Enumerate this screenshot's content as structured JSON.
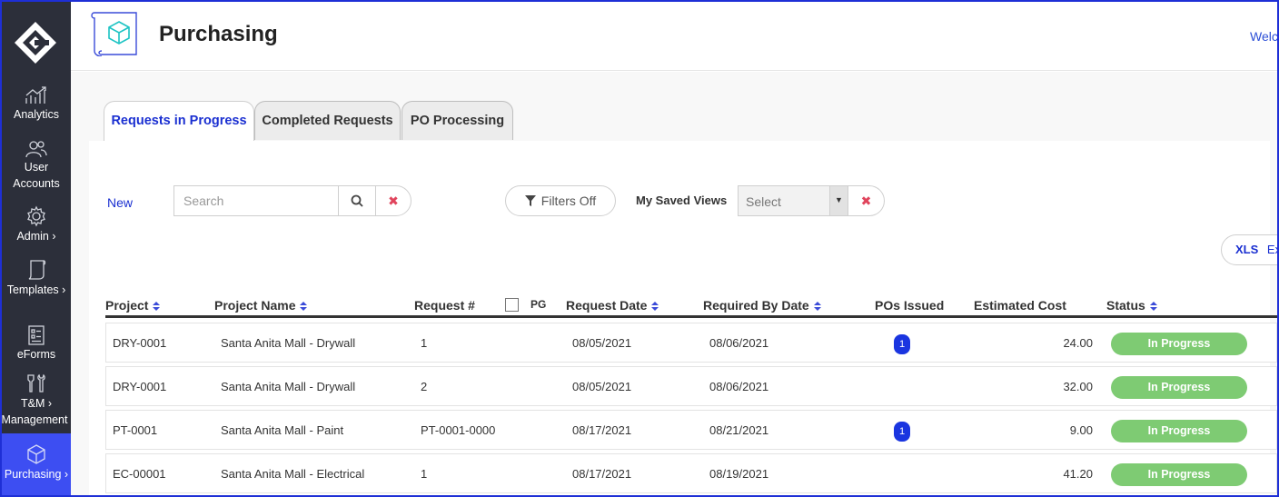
{
  "sidebar": {
    "items": [
      {
        "id": "analytics",
        "label": "Analytics",
        "icon": "chart-up-icon"
      },
      {
        "id": "user-accounts",
        "label": "User Accounts",
        "icon": "users-icon"
      },
      {
        "id": "admin",
        "label": "Admin ›",
        "icon": "gear-icon"
      },
      {
        "id": "templates",
        "label": "Templates ›",
        "icon": "scroll-icon"
      },
      {
        "id": "eforms",
        "label": "eForms",
        "icon": "form-icon"
      },
      {
        "id": "tm",
        "label": "T&M ›",
        "label2": "Management",
        "icon": "tools-icon"
      },
      {
        "id": "purchasing",
        "label": "Purchasing ›",
        "icon": "cube-icon",
        "active": true
      }
    ]
  },
  "header": {
    "title": "Purchasing",
    "welcome": "Welc"
  },
  "tabs": [
    {
      "label": "Requests in Progress",
      "active": true
    },
    {
      "label": "Completed Requests",
      "active": false
    },
    {
      "label": "PO Processing",
      "active": false
    }
  ],
  "toolbar": {
    "new_label": "New",
    "search_placeholder": "Search",
    "filters_label": "Filters Off",
    "saved_views_label": "My Saved Views",
    "saved_views_value": "Select",
    "xls_label": "XLS",
    "xls_suffix": "Ex"
  },
  "table": {
    "columns": {
      "project": "Project",
      "project_name": "Project Name",
      "request": "Request #",
      "pg": "PG",
      "request_date": "Request Date",
      "required_by": "Required By Date",
      "pos_issued": "POs Issued",
      "estimated_cost": "Estimated Cost",
      "status": "Status"
    },
    "rows": [
      {
        "project": "DRY-0001",
        "project_name": "Santa Anita Mall - Drywall",
        "request": "1",
        "request_date": "08/05/2021",
        "required_by": "08/06/2021",
        "pos_issued": "1",
        "estimated_cost": "24.00",
        "status": "In Progress"
      },
      {
        "project": "DRY-0001",
        "project_name": "Santa Anita Mall - Drywall",
        "request": "2",
        "request_date": "08/05/2021",
        "required_by": "08/06/2021",
        "pos_issued": "",
        "estimated_cost": "32.00",
        "status": "In Progress"
      },
      {
        "project": "PT-0001",
        "project_name": "Santa Anita Mall - Paint",
        "request": "PT-0001-0000",
        "request_date": "08/17/2021",
        "required_by": "08/21/2021",
        "pos_issued": "1",
        "estimated_cost": "9.00",
        "status": "In Progress"
      },
      {
        "project": "EC-00001",
        "project_name": "Santa Anita Mall - Electrical",
        "request": "1",
        "request_date": "08/17/2021",
        "required_by": "08/19/2021",
        "pos_issued": "",
        "estimated_cost": "41.20",
        "status": "In Progress"
      }
    ]
  },
  "colors": {
    "sidebar_bg": "#2c2f3a",
    "accent": "#1a2fd1",
    "active_nav": "#3d4ef2",
    "status_green": "#7ecb73",
    "clear_red": "#e0445c"
  }
}
